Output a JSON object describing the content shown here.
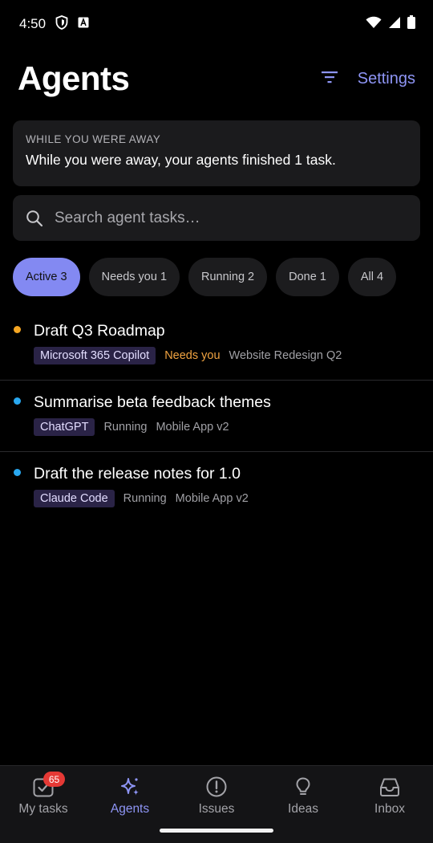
{
  "status_bar": {
    "time": "4:50"
  },
  "header": {
    "title": "Agents",
    "settings_label": "Settings"
  },
  "away_banner": {
    "caption": "WHILE YOU WERE AWAY",
    "message": "While you were away, your agents finished 1 task."
  },
  "search": {
    "placeholder": "Search agent tasks…",
    "value": ""
  },
  "filters": [
    {
      "label": "Active 3",
      "selected": true
    },
    {
      "label": "Needs you 1",
      "selected": false
    },
    {
      "label": "Running 2",
      "selected": false
    },
    {
      "label": "Done 1",
      "selected": false
    },
    {
      "label": "All 4",
      "selected": false
    }
  ],
  "tasks": [
    {
      "title": "Draft Q3 Roadmap",
      "agent": "Microsoft 365 Copilot",
      "status": "Needs you",
      "project": "Website Redesign Q2",
      "dot_color": "#f5a623"
    },
    {
      "title": "Summarise beta feedback themes",
      "agent": "ChatGPT",
      "status": "Running",
      "project": "Mobile App v2",
      "dot_color": "#29a8f0"
    },
    {
      "title": "Draft the release notes for 1.0",
      "agent": "Claude Code",
      "status": "Running",
      "project": "Mobile App v2",
      "dot_color": "#29a8f0"
    }
  ],
  "bottom_nav": {
    "items": [
      {
        "label": "My tasks",
        "icon": "checkbox-icon",
        "badge": "65"
      },
      {
        "label": "Agents",
        "icon": "sparkle-icon",
        "active": true
      },
      {
        "label": "Issues",
        "icon": "alert-circle-icon"
      },
      {
        "label": "Ideas",
        "icon": "lightbulb-icon"
      },
      {
        "label": "Inbox",
        "icon": "inbox-icon"
      }
    ]
  },
  "colors": {
    "accent": "#8e95f5",
    "chip_active": "#8389f2",
    "needs_you": "#f0a341",
    "running_dot": "#29a8f0",
    "needs_dot": "#f5a623",
    "badge": "#e53935"
  }
}
